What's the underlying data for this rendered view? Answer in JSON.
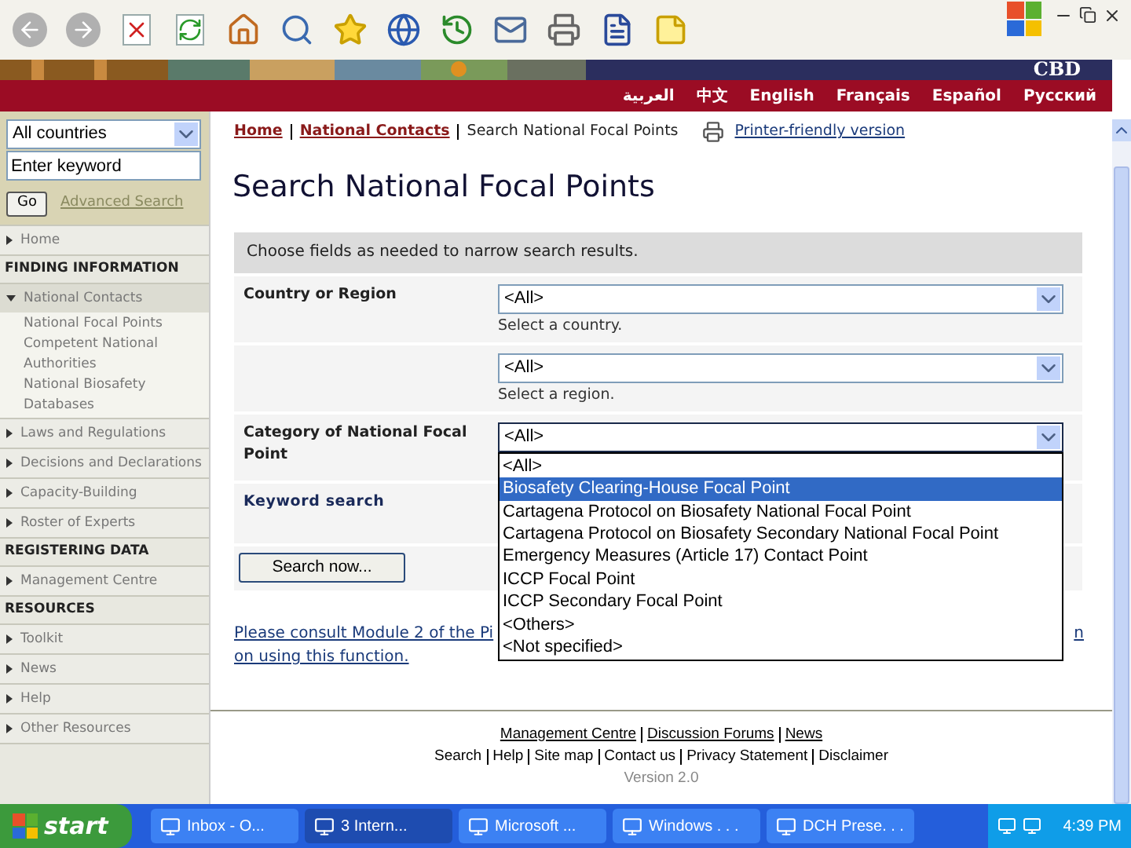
{
  "banner": {
    "logo": "CBD",
    "languages": [
      "العربية",
      "中文",
      "English",
      "Français",
      "Español",
      "Русский"
    ]
  },
  "sidebar": {
    "country_select": "All countries",
    "keyword_field": "Enter keyword",
    "go_button": "Go",
    "advanced_link": "Advanced Search",
    "nav": [
      {
        "kind": "link",
        "label": "Home",
        "expanded": false
      },
      {
        "kind": "heading",
        "label": "FINDING INFORMATION"
      },
      {
        "kind": "link",
        "label": "National Contacts",
        "expanded": true,
        "children": [
          {
            "label": "National Focal Points"
          },
          {
            "label": "Competent National Authorities"
          },
          {
            "label": "National Biosafety Databases"
          }
        ]
      },
      {
        "kind": "link",
        "label": "Laws and Regulations",
        "expanded": false
      },
      {
        "kind": "link",
        "label": "Decisions and Declarations",
        "expanded": false
      },
      {
        "kind": "link",
        "label": "Capacity-Building",
        "expanded": false
      },
      {
        "kind": "link",
        "label": "Roster of Experts",
        "expanded": false
      },
      {
        "kind": "heading",
        "label": "REGISTERING DATA"
      },
      {
        "kind": "link",
        "label": "Management Centre",
        "expanded": false
      },
      {
        "kind": "heading",
        "label": "RESOURCES"
      },
      {
        "kind": "link",
        "label": "Toolkit",
        "expanded": false
      },
      {
        "kind": "link",
        "label": "News",
        "expanded": false
      },
      {
        "kind": "link",
        "label": "Help",
        "expanded": false
      },
      {
        "kind": "link",
        "label": "Other Resources",
        "expanded": false
      }
    ]
  },
  "breadcrumb": [
    {
      "kind": "link",
      "label": "Home"
    },
    {
      "kind": "link",
      "label": "National Contacts"
    },
    {
      "kind": "current",
      "label": "Search National Focal Points"
    }
  ],
  "printer_link": "Printer-friendly version",
  "title": "Search National Focal Points",
  "form": {
    "instructions": "Choose fields as needed to narrow search results.",
    "fields": [
      {
        "label": "Country or Region",
        "value": "<All>",
        "hint": "Select a country.",
        "open": false
      },
      {
        "value": "<All>",
        "hint": "Select a region.",
        "open": false
      },
      {
        "label": "Category of National Focal Point",
        "value": "<All>",
        "open": true
      }
    ],
    "options": [
      {
        "label": "<All>",
        "selected": false
      },
      {
        "label": "Biosafety Clearing-House Focal Point",
        "selected": true
      },
      {
        "label": "Cartagena Protocol on Biosafety National Focal Point",
        "selected": false
      },
      {
        "label": "Cartagena Protocol on Biosafety Secondary National Focal Point",
        "selected": false
      },
      {
        "label": "Emergency Measures (Article 17) Contact Point",
        "selected": false
      },
      {
        "label": "ICCP Focal Point",
        "selected": false
      },
      {
        "label": "ICCP Secondary Focal Point",
        "selected": false
      },
      {
        "label": "<Others>",
        "selected": false
      },
      {
        "label": "<Not specified>",
        "selected": false
      }
    ],
    "keyword_label": "Keyword search",
    "search_button": "Search now..."
  },
  "help_text": {
    "start": "Please consult Module 2 of the Pi",
    "end": "n",
    "line2": "on using this function."
  },
  "footer": {
    "links_1": [
      "Management Centre",
      "Discussion Forums",
      "News"
    ],
    "links_2": [
      "Search",
      "Help",
      "Site map",
      "Contact us",
      "Privacy Statement",
      "Disclaimer"
    ],
    "version": "Version 2.0"
  },
  "taskbar": {
    "start": "start",
    "tasks": [
      {
        "label": "Inbox - O...",
        "selected": false
      },
      {
        "label": "3 Intern...",
        "selected": true
      },
      {
        "label": "Microsoft ...",
        "selected": false
      },
      {
        "label": "Windows . . .",
        "selected": false
      },
      {
        "label": "DCH Prese. . .",
        "selected": false
      }
    ],
    "clock": "4:39 PM"
  }
}
